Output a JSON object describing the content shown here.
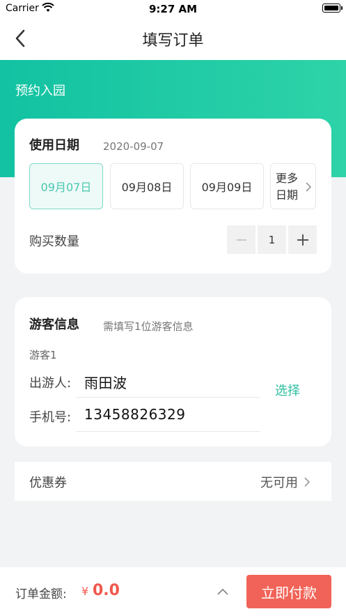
{
  "status_bar": {
    "carrier": "Carrier",
    "time": "9:27 AM"
  },
  "nav": {
    "title": "填写订单"
  },
  "header": {
    "section_label": "预约入园"
  },
  "date_card": {
    "title": "使用日期",
    "selected_date": "2020-09-07",
    "dates": [
      {
        "label": "09月07日",
        "active": true
      },
      {
        "label": "09月08日",
        "active": false
      },
      {
        "label": "09月09日",
        "active": false
      }
    ],
    "more_label": "更多日期",
    "quantity_label": "购买数量",
    "quantity": "1"
  },
  "visitor_card": {
    "title": "游客信息",
    "subtitle": "需填写1位游客信息",
    "visitor_label": "游客1",
    "name_label": "出游人:",
    "name_value": "雨田波",
    "phone_label": "手机号:",
    "phone_value": "13458826329",
    "select_label": "选择"
  },
  "coupon": {
    "label": "优惠券",
    "value": "无可用"
  },
  "footer": {
    "amount_label": "订单金额:",
    "currency": "¥",
    "amount": "0.0",
    "pay_label": "立即付款"
  },
  "colors": {
    "accent": "#12c2a2",
    "pay": "#f16358",
    "price": "#f0584d"
  }
}
